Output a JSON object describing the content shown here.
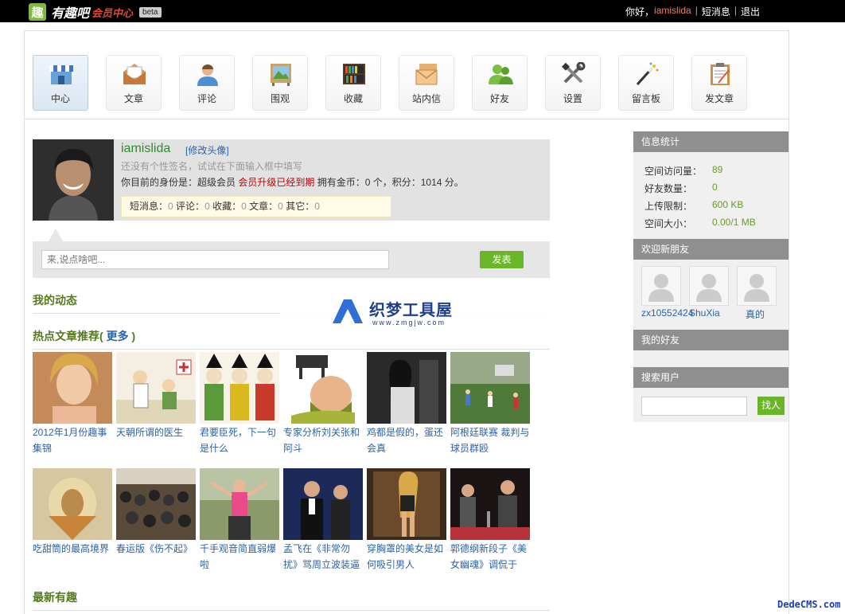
{
  "topbar": {
    "logo_mark": "趣",
    "site_name": "有趣吧",
    "site_sub": "会员中心",
    "beta": "beta",
    "greeting": "你好，",
    "username": "iamislida",
    "messages": "短消息",
    "logout": "退出"
  },
  "nav": [
    {
      "label": "中心",
      "icon": "home-store-icon"
    },
    {
      "label": "文章",
      "icon": "envelope-open-icon"
    },
    {
      "label": "评论",
      "icon": "user-icon"
    },
    {
      "label": "围观",
      "icon": "picture-icon"
    },
    {
      "label": "收藏",
      "icon": "bookshelf-icon"
    },
    {
      "label": "站内信",
      "icon": "mail-stack-icon"
    },
    {
      "label": "好友",
      "icon": "friends-icon"
    },
    {
      "label": "设置",
      "icon": "tools-icon"
    },
    {
      "label": "留言板",
      "icon": "magic-wand-icon"
    },
    {
      "label": "发文章",
      "icon": "clipboard-icon"
    }
  ],
  "profile": {
    "name": "iamislida",
    "edit_avatar": "[修改头像]",
    "signature_hint": "还没有个性签名，试试在下面输入框中填写",
    "identity_prefix": "你目前的身份是：超级会员",
    "upgrade_expired": "会员升级已经到期",
    "coins_points": "拥有金币：0 个，积分：1014 分。",
    "counts": {
      "msg_label": "短消息：",
      "msg": "0",
      "comment_label": "评论：",
      "comment": "0",
      "fav_label": "收藏：",
      "fav": "0",
      "article_label": "文章：",
      "article": "0",
      "other_label": "其它：",
      "other": "0"
    }
  },
  "post": {
    "placeholder": "来,说点啥吧...",
    "submit": "发表"
  },
  "sections": {
    "activity": "我的动态",
    "hot_prefix": "热点文章推荐(",
    "hot_more": "更多",
    "hot_suffix": ")",
    "latest": "最新有趣"
  },
  "watermark": {
    "name": "织梦工具屋",
    "url": "www.zmgjw.com"
  },
  "articles": [
    {
      "title": "2012年1月份趣事集锦"
    },
    {
      "title": "天朝所谓的医生"
    },
    {
      "title": "君要臣死，下一句是什么"
    },
    {
      "title": "专家分析刘关张和阿斗"
    },
    {
      "title": "鸡都是假的，蛋还会真"
    },
    {
      "title": "阿根廷联赛 裁判与球员群殴"
    },
    {
      "title": "吃甜筒的最高境界"
    },
    {
      "title": "春运版《伤不起》"
    },
    {
      "title": "千手观音简直弱爆啦"
    },
    {
      "title": "孟飞在《非常勿扰》骂周立波装逼"
    },
    {
      "title": "穿胸罩的美女是如何吸引男人"
    },
    {
      "title": "郭德纲新段子《美女幽魂》调侃于"
    }
  ],
  "sidebar": {
    "stats_title": "信息统计",
    "stats": [
      {
        "label": "空间访问量：",
        "value": "89"
      },
      {
        "label": "好友数量：",
        "value": "0"
      },
      {
        "label": "上传限制：",
        "value": "600 KB"
      },
      {
        "label": "空间大小：",
        "value": "0.00/1 MB"
      }
    ],
    "new_friends_title": "欢迎新朋友",
    "new_friends": [
      {
        "name": "zx10552424"
      },
      {
        "name": "ShuXia"
      },
      {
        "name": "真的"
      }
    ],
    "my_friends_title": "我的好友",
    "search_title": "搜索用户",
    "search_button": "找人"
  },
  "footer_mark": "DedeCMS.com"
}
